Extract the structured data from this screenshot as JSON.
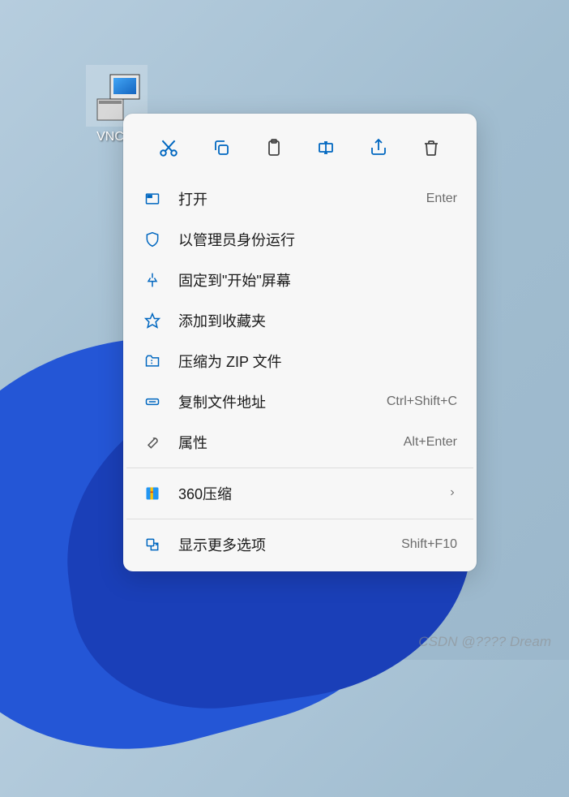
{
  "desktop": {
    "icon_label": "VNC-S"
  },
  "menu": {
    "items": [
      {
        "label": "打开",
        "shortcut": "Enter"
      },
      {
        "label": "以管理员身份运行",
        "shortcut": ""
      },
      {
        "label": "固定到\"开始\"屏幕",
        "shortcut": ""
      },
      {
        "label": "添加到收藏夹",
        "shortcut": ""
      },
      {
        "label": "压缩为 ZIP 文件",
        "shortcut": ""
      },
      {
        "label": "复制文件地址",
        "shortcut": "Ctrl+Shift+C"
      },
      {
        "label": "属性",
        "shortcut": "Alt+Enter"
      },
      {
        "label": "360压缩",
        "shortcut": ""
      },
      {
        "label": "显示更多选项",
        "shortcut": "Shift+F10"
      }
    ]
  },
  "watermark": "CSDN @????  Dream"
}
